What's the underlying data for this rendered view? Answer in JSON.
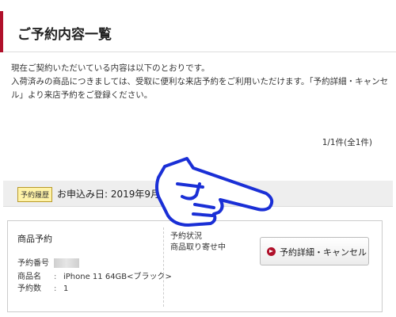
{
  "page": {
    "title": "ご予約内容一覧",
    "accent_color": "#b0102a"
  },
  "intro": {
    "line1": "現在ご契約いただいている内容は以下のとおりです。",
    "line2": "入荷済みの商品につきましては、受取に便利な来店予約をご利用いただけます。「予約詳細・キャンセル」より来店予約をご登録ください。"
  },
  "result_count": "1/1件(全1件)",
  "history": {
    "badge": "予約履歴",
    "apply_date": "お申込み日: 2019年9月14日"
  },
  "reservation": {
    "title": "商品予約",
    "fields": [
      {
        "label": "予約番号",
        "sep": ":",
        "value": ""
      },
      {
        "label": "商品名",
        "sep": ":",
        "value": "iPhone 11 64GB<ブラック>"
      },
      {
        "label": "予約数",
        "sep": ":",
        "value": "1"
      }
    ],
    "status_label": "予約状況",
    "status_value": "商品取り寄せ中",
    "button_label": "予約詳細・キャンセル",
    "button_icon": "chevron-right-circle-icon"
  },
  "annotation": {
    "icon": "pointing-hand-icon",
    "color": "#1a2fd6"
  }
}
